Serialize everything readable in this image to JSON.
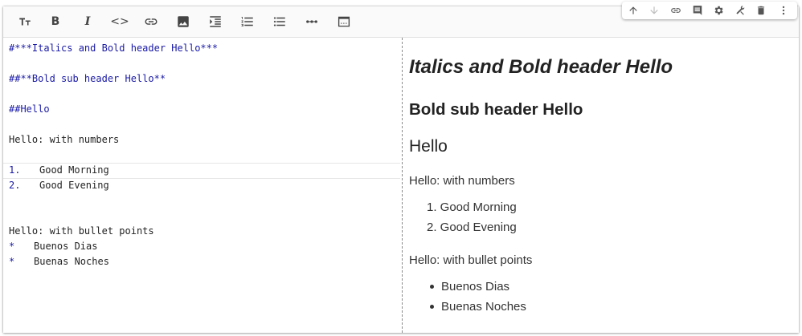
{
  "toolbar": {
    "buttons": [
      {
        "name": "text-size",
        "label": "TT"
      },
      {
        "name": "bold",
        "label": "B"
      },
      {
        "name": "italic",
        "label": "I"
      },
      {
        "name": "code",
        "label": "<>"
      },
      {
        "name": "link",
        "label": "link-icon"
      },
      {
        "name": "image",
        "label": "image-icon"
      },
      {
        "name": "indent",
        "label": "indent-icon"
      },
      {
        "name": "numbered-list",
        "label": "numbered-list-icon"
      },
      {
        "name": "bullet-list",
        "label": "bullet-list-icon"
      },
      {
        "name": "horizontal-rule",
        "label": "more-horiz-icon"
      },
      {
        "name": "toggle-preview",
        "label": "preview-icon"
      }
    ],
    "bold_label": "B",
    "italic_label": "I",
    "code_label": "<>"
  },
  "mini_toolbar": {
    "icons": [
      "arrow-up-icon",
      "arrow-down-icon",
      "link-icon",
      "comment-icon",
      "gear-icon",
      "tools-icon",
      "trash-icon",
      "more-vert-icon"
    ]
  },
  "source": {
    "line1": "#***Italics and Bold header Hello***",
    "line2": "##**Bold sub header Hello**",
    "line3": "##Hello",
    "line4": "Hello: with numbers",
    "ol1_marker": "1.",
    "ol1_text": "Good Morning",
    "ol2_marker": "2.",
    "ol2_text": "Good Evening",
    "line5": "Hello: with bullet points",
    "ul1_marker": "*",
    "ul1_text": "Buenos Dias",
    "ul2_marker": "*",
    "ul2_text": "Buenas Noches"
  },
  "preview": {
    "h1": "Italics and Bold header Hello",
    "h2": "Bold sub header Hello",
    "h3": "Hello",
    "numbers_intro": "Hello: with numbers",
    "ol": [
      "1. Good Morning",
      "2. Good Evening"
    ],
    "bullets_intro": "Hello: with bullet points",
    "ul": [
      "Buenos Dias",
      "Buenas Noches"
    ]
  }
}
